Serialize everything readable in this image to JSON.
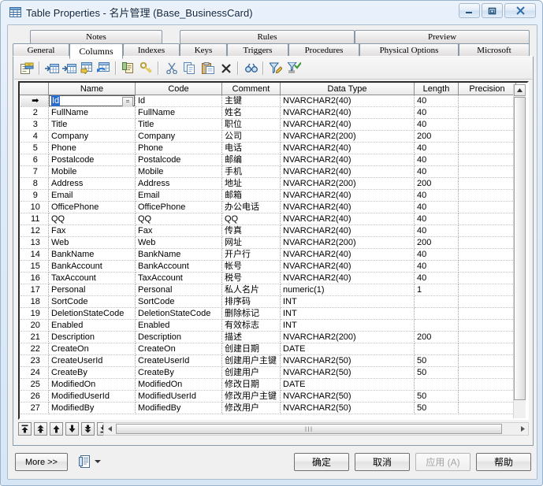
{
  "window": {
    "title": "Table Properties - 名片管理 (Base_BusinessCard)",
    "icon": "table-icon",
    "controls": {
      "minimize": "minimize-icon",
      "maximize": "maximize-icon",
      "close": "close-icon"
    }
  },
  "tabs": {
    "row1": [
      {
        "label": "Notes",
        "active": false
      },
      {
        "label": "Rules",
        "active": false
      },
      {
        "label": "Preview",
        "active": false
      }
    ],
    "row2": [
      {
        "label": "General",
        "active": false
      },
      {
        "label": "Columns",
        "active": true
      },
      {
        "label": "Indexes",
        "active": false
      },
      {
        "label": "Keys",
        "active": false
      },
      {
        "label": "Triggers",
        "active": false
      },
      {
        "label": "Procedures",
        "active": false
      },
      {
        "label": "Physical Options",
        "active": false
      },
      {
        "label": "Microsoft",
        "active": false
      }
    ]
  },
  "toolbar": {
    "buttons": [
      {
        "name": "properties-icon",
        "title": "Properties"
      },
      {
        "name": "insert-row-icon",
        "title": "Insert a Row"
      },
      {
        "name": "insert-row-after-icon",
        "title": "Insert a Row After"
      },
      {
        "name": "add-a-row-icon",
        "title": "Add a Row"
      },
      {
        "name": "replace-row-icon",
        "title": "Replace a Row"
      },
      {
        "name": "duplicate-icon",
        "title": "Duplicate"
      },
      {
        "name": "primary-key-icon",
        "title": "Primary Key"
      },
      {
        "name": "cut-icon",
        "title": "Cut"
      },
      {
        "name": "copy-icon",
        "title": "Copy"
      },
      {
        "name": "paste-icon",
        "title": "Paste"
      },
      {
        "name": "delete-icon",
        "title": "Delete"
      },
      {
        "name": "find-icon",
        "title": "Find"
      },
      {
        "name": "filter-edit-icon",
        "title": "Customize Filter"
      },
      {
        "name": "filter-apply-icon",
        "title": "Apply Filter"
      }
    ]
  },
  "grid": {
    "headers": [
      "",
      "Name",
      "Code",
      "Comment",
      "Data Type",
      "Length",
      "Precision"
    ],
    "current_row_index": 1,
    "current_cell_value": "Id",
    "current_cell_button": "=",
    "row_marker": "➡",
    "rows": [
      {
        "n": "",
        "name": "Id",
        "code": "Id",
        "comment": "主键",
        "type": "NVARCHAR2(40)",
        "length": "40",
        "precision": ""
      },
      {
        "n": "2",
        "name": "FullName",
        "code": "FullName",
        "comment": "姓名",
        "type": "NVARCHAR2(40)",
        "length": "40",
        "precision": ""
      },
      {
        "n": "3",
        "name": "Title",
        "code": "Title",
        "comment": "职位",
        "type": "NVARCHAR2(40)",
        "length": "40",
        "precision": ""
      },
      {
        "n": "4",
        "name": "Company",
        "code": "Company",
        "comment": "公司",
        "type": "NVARCHAR2(200)",
        "length": "200",
        "precision": ""
      },
      {
        "n": "5",
        "name": "Phone",
        "code": "Phone",
        "comment": "电话",
        "type": "NVARCHAR2(40)",
        "length": "40",
        "precision": ""
      },
      {
        "n": "6",
        "name": "Postalcode",
        "code": "Postalcode",
        "comment": "邮编",
        "type": "NVARCHAR2(40)",
        "length": "40",
        "precision": ""
      },
      {
        "n": "7",
        "name": "Mobile",
        "code": "Mobile",
        "comment": "手机",
        "type": "NVARCHAR2(40)",
        "length": "40",
        "precision": ""
      },
      {
        "n": "8",
        "name": "Address",
        "code": "Address",
        "comment": "地址",
        "type": "NVARCHAR2(200)",
        "length": "200",
        "precision": ""
      },
      {
        "n": "9",
        "name": "Email",
        "code": "Email",
        "comment": "邮箱",
        "type": "NVARCHAR2(40)",
        "length": "40",
        "precision": ""
      },
      {
        "n": "10",
        "name": "OfficePhone",
        "code": "OfficePhone",
        "comment": "办公电话",
        "type": "NVARCHAR2(40)",
        "length": "40",
        "precision": ""
      },
      {
        "n": "11",
        "name": "QQ",
        "code": "QQ",
        "comment": "QQ",
        "type": "NVARCHAR2(40)",
        "length": "40",
        "precision": ""
      },
      {
        "n": "12",
        "name": "Fax",
        "code": "Fax",
        "comment": "传真",
        "type": "NVARCHAR2(40)",
        "length": "40",
        "precision": ""
      },
      {
        "n": "13",
        "name": "Web",
        "code": "Web",
        "comment": "网址",
        "type": "NVARCHAR2(200)",
        "length": "200",
        "precision": ""
      },
      {
        "n": "14",
        "name": "BankName",
        "code": "BankName",
        "comment": "开户行",
        "type": "NVARCHAR2(40)",
        "length": "40",
        "precision": ""
      },
      {
        "n": "15",
        "name": "BankAccount",
        "code": "BankAccount",
        "comment": "帐号",
        "type": "NVARCHAR2(40)",
        "length": "40",
        "precision": ""
      },
      {
        "n": "16",
        "name": "TaxAccount",
        "code": "TaxAccount",
        "comment": "税号",
        "type": "NVARCHAR2(40)",
        "length": "40",
        "precision": ""
      },
      {
        "n": "17",
        "name": "Personal",
        "code": "Personal",
        "comment": "私人名片",
        "type": "numeric(1)",
        "length": "1",
        "precision": ""
      },
      {
        "n": "18",
        "name": "SortCode",
        "code": "SortCode",
        "comment": "排序码",
        "type": "INT",
        "length": "",
        "precision": ""
      },
      {
        "n": "19",
        "name": "DeletionStateCode",
        "code": "DeletionStateCode",
        "comment": "删除标记",
        "type": "INT",
        "length": "",
        "precision": ""
      },
      {
        "n": "20",
        "name": "Enabled",
        "code": "Enabled",
        "comment": "有效标志",
        "type": "INT",
        "length": "",
        "precision": ""
      },
      {
        "n": "21",
        "name": "Description",
        "code": "Description",
        "comment": "描述",
        "type": "NVARCHAR2(200)",
        "length": "200",
        "precision": ""
      },
      {
        "n": "22",
        "name": "CreateOn",
        "code": "CreateOn",
        "comment": "创建日期",
        "type": "DATE",
        "length": "",
        "precision": ""
      },
      {
        "n": "23",
        "name": "CreateUserId",
        "code": "CreateUserId",
        "comment": "创建用户主键",
        "type": "NVARCHAR2(50)",
        "length": "50",
        "precision": ""
      },
      {
        "n": "24",
        "name": "CreateBy",
        "code": "CreateBy",
        "comment": "创建用户",
        "type": "NVARCHAR2(50)",
        "length": "50",
        "precision": ""
      },
      {
        "n": "25",
        "name": "ModifiedOn",
        "code": "ModifiedOn",
        "comment": "修改日期",
        "type": "DATE",
        "length": "",
        "precision": ""
      },
      {
        "n": "26",
        "name": "ModifiedUserId",
        "code": "ModifiedUserId",
        "comment": "修改用户主键",
        "type": "NVARCHAR2(50)",
        "length": "50",
        "precision": ""
      },
      {
        "n": "27",
        "name": "ModifiedBy",
        "code": "ModifiedBy",
        "comment": "修改用户",
        "type": "NVARCHAR2(50)",
        "length": "50",
        "precision": ""
      }
    ]
  },
  "navbar": {
    "buttons": [
      {
        "name": "nav-first-button",
        "glyph": "first"
      },
      {
        "name": "nav-prev-page-button",
        "glyph": "prev-page"
      },
      {
        "name": "nav-prev-button",
        "glyph": "prev"
      },
      {
        "name": "nav-next-button",
        "glyph": "next"
      },
      {
        "name": "nav-next-page-button",
        "glyph": "next-page"
      },
      {
        "name": "nav-last-button",
        "glyph": "last"
      }
    ],
    "hscroll_grip": "III"
  },
  "bottom": {
    "more_label": "More >>",
    "report_icon": "report-icon",
    "report_caret": "caret-down-icon",
    "ok_label": "确定",
    "cancel_label": "取消",
    "apply_label": "应用 (A)",
    "apply_disabled": true,
    "help_label": "帮助"
  },
  "colors": {
    "title_text": "#0b2440",
    "selection_blue": "#2a6ccb",
    "window_border": "#9ab3cc",
    "tab_active_bg": "#ffffff"
  }
}
